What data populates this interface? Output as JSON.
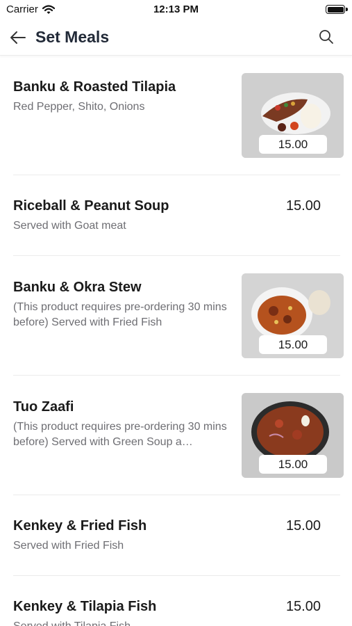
{
  "status_bar": {
    "carrier": "Carrier",
    "time": "12:13 PM"
  },
  "nav": {
    "title": "Set Meals",
    "back_icon": "arrow-left-icon",
    "search_icon": "search-icon"
  },
  "items": [
    {
      "name": "Banku & Roasted Tilapia",
      "description": "Red Pepper, Shito, Onions",
      "price": "15.00",
      "has_image": true
    },
    {
      "name": "Riceball & Peanut Soup",
      "description": "Served with Goat meat",
      "price": "15.00",
      "has_image": false
    },
    {
      "name": "Banku & Okra Stew",
      "description": "(This product requires pre-ordering 30 mins before) Served with Fried Fish",
      "price": "15.00",
      "has_image": true
    },
    {
      "name": "Tuo Zaafi",
      "description": "(This product requires pre-ordering 30 mins before) Served with Green Soup a…",
      "price": "15.00",
      "has_image": true
    },
    {
      "name": "Kenkey & Fried Fish",
      "description": "Served with Fried Fish",
      "price": "15.00",
      "has_image": false
    },
    {
      "name": "Kenkey & Tilapia Fish",
      "description": "Served with Tilapia Fish",
      "price": "15.00",
      "has_image": false
    }
  ]
}
